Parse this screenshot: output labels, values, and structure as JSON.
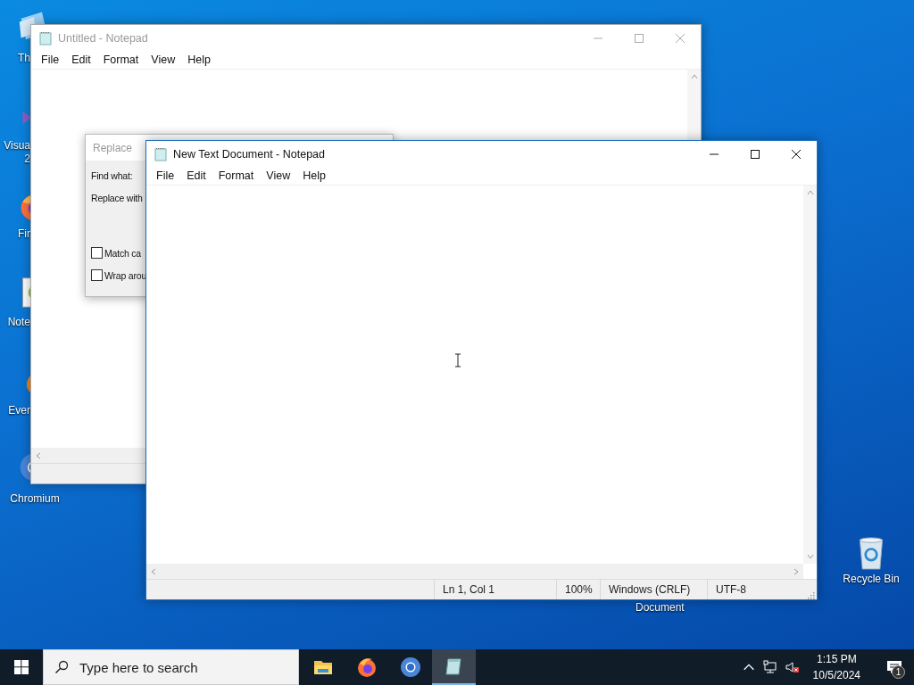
{
  "desktop_icons": [
    {
      "kind": "folder",
      "label": "Th"
    },
    {
      "kind": "studio",
      "label": "Visua\n2"
    },
    {
      "kind": "firefox",
      "label": "Fir"
    },
    {
      "kind": "notepadpp",
      "label": "Note"
    },
    {
      "kind": "evernote",
      "label": "Ever"
    },
    {
      "kind": "chromium",
      "label": "Chromium"
    },
    {
      "kind": "recycle",
      "label": "Recycle Bin"
    },
    {
      "kind": "none",
      "label": "Document"
    }
  ],
  "background_notepad": {
    "title": "Untitled - Notepad",
    "active": false,
    "menu": [
      "File",
      "Edit",
      "Format",
      "View",
      "Help"
    ]
  },
  "replace_dialog": {
    "title": "Replace",
    "find_label": "Find what:",
    "replace_label": "Replace with",
    "options": [
      {
        "label": "Match ca",
        "checked": false
      },
      {
        "label": "Wrap arou",
        "checked": false
      }
    ]
  },
  "notepad": {
    "title": "New Text Document - Notepad",
    "active": true,
    "menu": [
      "File",
      "Edit",
      "Format",
      "View",
      "Help"
    ],
    "status_bar": [
      "Ln 1, Col 1",
      "100%",
      "Windows (CRLF)",
      "UTF-8"
    ]
  },
  "taskbar": {
    "search": {
      "placeholder": "Type here to search"
    },
    "apps": [
      {
        "kind": "files",
        "selected": false
      },
      {
        "kind": "firefox",
        "selected": false
      },
      {
        "kind": "chromium",
        "selected": false
      },
      {
        "kind": "notepad",
        "selected": true
      }
    ],
    "clock": {
      "time": "1:15 PM",
      "date": "10/5/2024"
    },
    "notifications": {
      "count": "1"
    }
  }
}
